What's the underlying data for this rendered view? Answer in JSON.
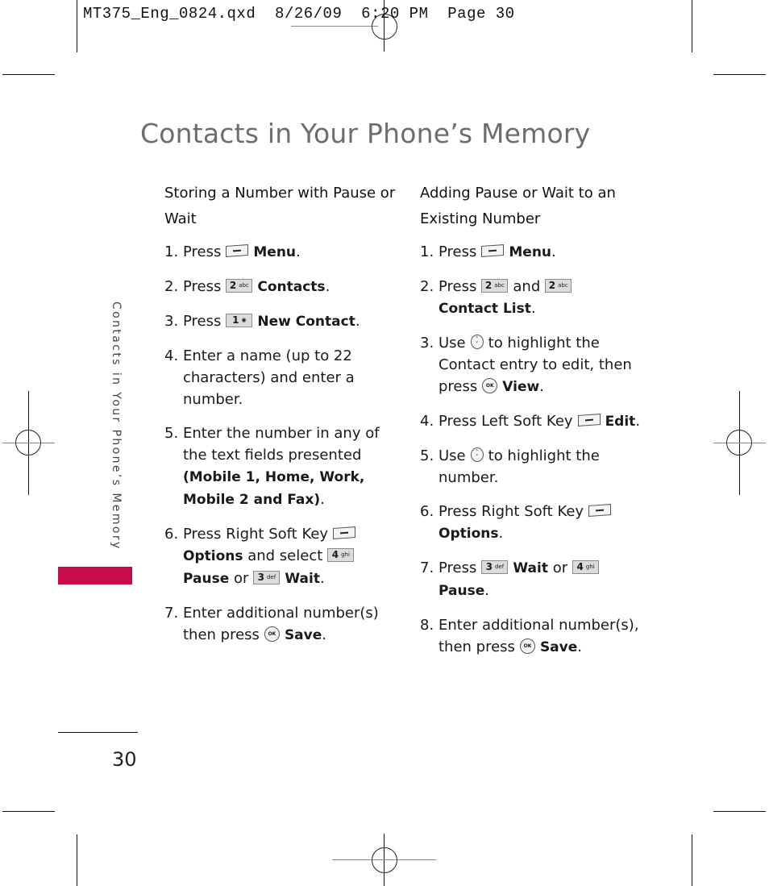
{
  "slug": "MT375_Eng_0824.qxd  8/26/09  6:20 PM  Page 30",
  "title": "Contacts in Your Phone’s Memory",
  "side_tab": {
    "label": "Contacts in Your Phone’s Memory",
    "accent_color": "#c80c4b"
  },
  "page_number": "30",
  "left_column": {
    "heading": "Storing a Number with Pause or Wait",
    "steps": [
      {
        "num": "1.",
        "pre": "Press",
        "key": "soft-key-icon",
        "bold": "Menu",
        "post": "."
      },
      {
        "num": "2.",
        "pre": "Press",
        "key_label": "2",
        "key_sub": "abc",
        "bold": "Contacts",
        "post": "."
      },
      {
        "num": "3.",
        "pre": "Press",
        "key_label": "1",
        "key_sub": "voicemail",
        "bold": "New Contact",
        "post": "."
      },
      {
        "num": "4.",
        "text": "Enter a name (up to 22 characters) and enter a number."
      },
      {
        "num": "5.",
        "text": "Enter the number in any of the text fields presented",
        "bold": "(Mobile 1, Home, Work, Mobile 2 and Fax)",
        "post": "."
      },
      {
        "num": "6.",
        "pre": "Press Right Soft Key",
        "bold1": "Options",
        "mid": "and select",
        "key1_label": "4",
        "key1_sub": "ghi",
        "bold2": "Pause",
        "or": "or",
        "key2_label": "3",
        "key2_sub": "def",
        "bold3": "Wait",
        "post": "."
      },
      {
        "num": "7.",
        "pre": "Enter additional number(s) then press",
        "ok": "OK",
        "bold": "Save",
        "post": "."
      }
    ]
  },
  "right_column": {
    "heading": "Adding Pause or Wait to an Existing Number",
    "steps": [
      {
        "num": "1.",
        "pre": "Press",
        "bold": "Menu",
        "post": "."
      },
      {
        "num": "2.",
        "pre": "Press",
        "key1_label": "2",
        "key1_sub": "abc",
        "and": "and",
        "key2_label": "2",
        "key2_sub": "abc",
        "bold": "Contact List",
        "post": "."
      },
      {
        "num": "3.",
        "pre": "Use",
        "mid": "to highlight the Contact entry to edit, then press",
        "ok": "OK",
        "bold": "View",
        "post": "."
      },
      {
        "num": "4.",
        "pre": "Press Left Soft Key",
        "bold": "Edit",
        "post": "."
      },
      {
        "num": "5.",
        "pre": "Use",
        "mid": "to highlight the number."
      },
      {
        "num": "6.",
        "pre": "Press Right Soft Key",
        "bold": "Options",
        "post": "."
      },
      {
        "num": "7.",
        "pre": "Press",
        "key1_label": "3",
        "key1_sub": "def",
        "bold1": "Wait",
        "or": "or",
        "key2_label": "4",
        "key2_sub": "ghi",
        "bold2": "Pause",
        "post": "."
      },
      {
        "num": "8.",
        "pre": "Enter additional number(s), then press",
        "ok": "OK",
        "bold": "Save",
        "post": "."
      }
    ]
  }
}
